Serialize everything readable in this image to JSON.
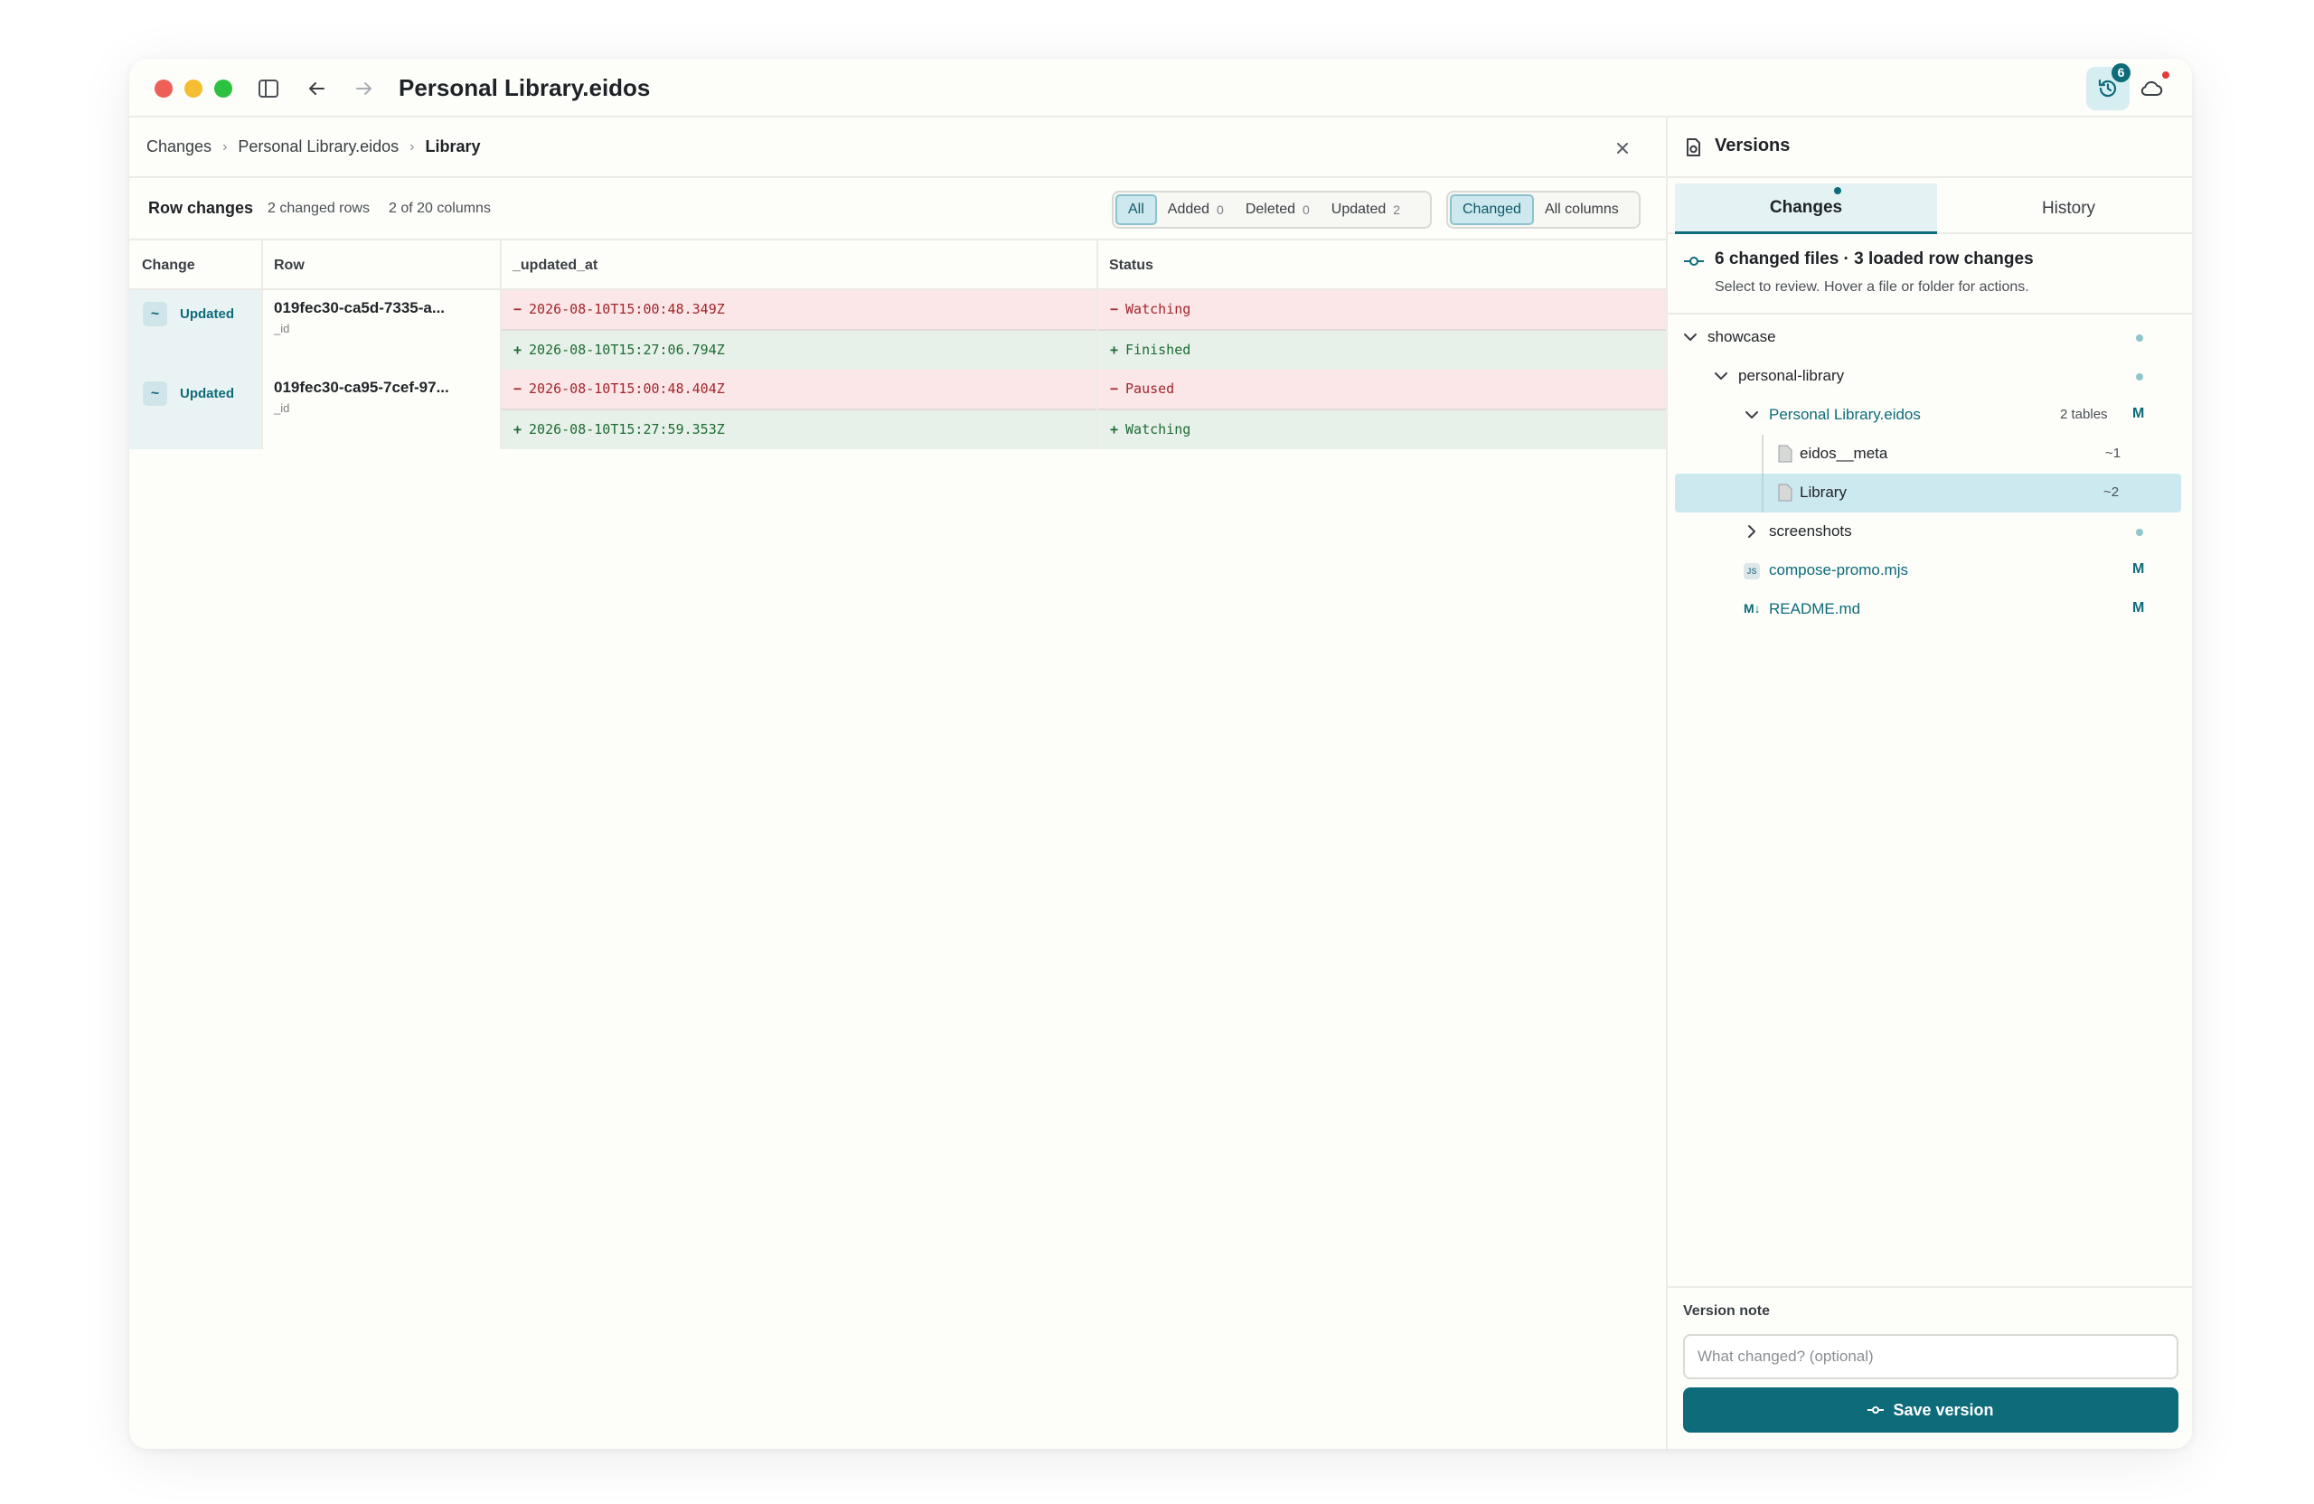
{
  "app": {
    "title": "Personal Library.eidos",
    "versions_badge": "6"
  },
  "breadcrumb": {
    "items": [
      "Changes",
      "Personal Library.eidos"
    ],
    "current": "Library"
  },
  "row_changes": {
    "title": "Row changes",
    "changed_rows": "2 changed rows",
    "columns_info": "2 of 20 columns",
    "filters": [
      {
        "label": "All",
        "count": "",
        "active": true
      },
      {
        "label": "Added",
        "count": "0",
        "active": false
      },
      {
        "label": "Deleted",
        "count": "0",
        "active": false
      },
      {
        "label": "Updated",
        "count": "2",
        "active": false
      }
    ],
    "column_modes": [
      {
        "label": "Changed",
        "active": true
      },
      {
        "label": "All columns",
        "active": false
      }
    ]
  },
  "table": {
    "headers": [
      "Change",
      "Row",
      "_updated_at",
      "Status"
    ],
    "rows": [
      {
        "change": "Updated",
        "change_symbol": "~",
        "row_id": "019fec30-ca5d-7335-a...",
        "row_sub": "_id",
        "updated_at_old": "2026-08-10T15:00:48.349Z",
        "updated_at_new": "2026-08-10T15:27:06.794Z",
        "status_old": "Watching",
        "status_new": "Finished"
      },
      {
        "change": "Updated",
        "change_symbol": "~",
        "row_id": "019fec30-ca95-7cef-97...",
        "row_sub": "_id",
        "updated_at_old": "2026-08-10T15:00:48.404Z",
        "updated_at_new": "2026-08-10T15:27:59.353Z",
        "status_old": "Paused",
        "status_new": "Watching"
      }
    ],
    "minus": "−",
    "plus": "+"
  },
  "versions": {
    "title": "Versions",
    "tabs": [
      "Changes",
      "History"
    ],
    "summary_title": "6 changed files · 3 loaded row changes",
    "summary_sub": "Select to review. Hover a file or folder for actions.",
    "tree": [
      {
        "label": "showcase"
      },
      {
        "label": "personal-library"
      },
      {
        "label": "Personal Library.eidos",
        "extra": "2 tables",
        "status": "M"
      },
      {
        "label": "eidos__meta",
        "status": "~1"
      },
      {
        "label": "Library",
        "status": "~2"
      },
      {
        "label": "screenshots"
      },
      {
        "label": "compose-promo.mjs",
        "icon_text": "JS",
        "status": "M"
      },
      {
        "label": "README.md",
        "icon_text": "M↓",
        "status": "M"
      }
    ],
    "version_note_label": "Version note",
    "version_note_placeholder": "What changed? (optional)",
    "save_label": "Save version"
  },
  "colors": {
    "accent": "#0d6b7a",
    "deleted_bg": "#fbe7e7",
    "added_bg": "#e7f1e9",
    "selected_bg": "#cde9f0"
  }
}
